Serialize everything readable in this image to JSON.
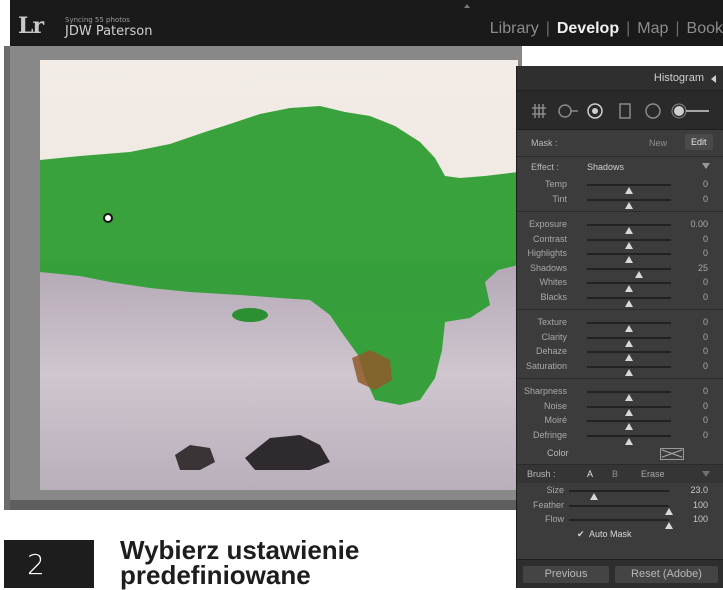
{
  "topbar": {
    "logo": "Lr",
    "sync_status": "Syncing 55 photos",
    "user_name": "JDW Paterson",
    "modules": [
      "Library",
      "Develop",
      "Map",
      "Book"
    ],
    "active_module": "Develop"
  },
  "panel": {
    "histogram_title": "Histogram",
    "tools": [
      "crop-overlay-icon",
      "spot-removal-icon",
      "red-eye-icon",
      "graduated-filter-icon",
      "radial-filter-icon",
      "adjustment-brush-icon"
    ],
    "mask_label": "Mask :",
    "mask_new": "New",
    "mask_edit": "Edit",
    "effect_label": "Effect :",
    "effect_value": "Shadows",
    "sliders_color": [
      {
        "label": "Temp",
        "value": "0",
        "pos": 0.5
      },
      {
        "label": "Tint",
        "value": "0",
        "pos": 0.5
      }
    ],
    "sliders_tone": [
      {
        "label": "Exposure",
        "value": "0.00",
        "pos": 0.5
      },
      {
        "label": "Contrast",
        "value": "0",
        "pos": 0.5
      },
      {
        "label": "Highlights",
        "value": "0",
        "pos": 0.5
      },
      {
        "label": "Shadows",
        "value": "25",
        "pos": 0.62
      },
      {
        "label": "Whites",
        "value": "0",
        "pos": 0.5
      },
      {
        "label": "Blacks",
        "value": "0",
        "pos": 0.5
      }
    ],
    "sliders_presence": [
      {
        "label": "Texture",
        "value": "0",
        "pos": 0.5
      },
      {
        "label": "Clarity",
        "value": "0",
        "pos": 0.5
      },
      {
        "label": "Dehaze",
        "value": "0",
        "pos": 0.5
      },
      {
        "label": "Saturation",
        "value": "0",
        "pos": 0.5
      }
    ],
    "sliders_detail": [
      {
        "label": "Sharpness",
        "value": "0",
        "pos": 0.5
      },
      {
        "label": "Noise",
        "value": "0",
        "pos": 0.5
      },
      {
        "label": "Moiré",
        "value": "0",
        "pos": 0.5
      },
      {
        "label": "Defringe",
        "value": "0",
        "pos": 0.5
      }
    ],
    "color_label": "Color",
    "brush_label": "Brush :",
    "brush_a": "A",
    "brush_b": "B",
    "brush_erase": "Erase",
    "brush_sliders": [
      {
        "label": "Size",
        "value": "23.0",
        "pos": 0.25
      },
      {
        "label": "Feather",
        "value": "100",
        "pos": 1.0
      },
      {
        "label": "Flow",
        "value": "100",
        "pos": 1.0
      }
    ],
    "auto_mask_check": "✔",
    "auto_mask_label": "Auto Mask",
    "previous_button": "Previous",
    "reset_button": "Reset (Adobe)"
  },
  "step": {
    "number": "2",
    "title": "Wybierz ustawienie predefiniowane"
  },
  "colors": {
    "mask_overlay": "#2e9e34",
    "topbar_bg": "#1a1a1a",
    "panel_bg": "#3c3c3c"
  }
}
